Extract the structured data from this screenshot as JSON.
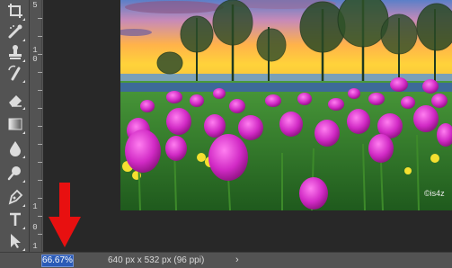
{
  "status": {
    "zoom": "66.67%",
    "doc_info": "640 px x 532 px (96 ppi)",
    "menu_chevron": "›"
  },
  "ruler": {
    "numbers": [
      "5",
      "1",
      "0",
      "1",
      "0",
      "1"
    ]
  },
  "canvas": {
    "watermark": "©is4z"
  },
  "annotation": {
    "arrow_color": "#e81010"
  },
  "tools": [
    "crop-icon",
    "healing-brush-icon",
    "clone-stamp-icon",
    "history-brush-icon",
    "eraser-icon",
    "gradient-icon",
    "blur-icon",
    "dodge-icon",
    "pen-icon",
    "type-icon",
    "path-selection-icon",
    "rectangle-icon"
  ]
}
